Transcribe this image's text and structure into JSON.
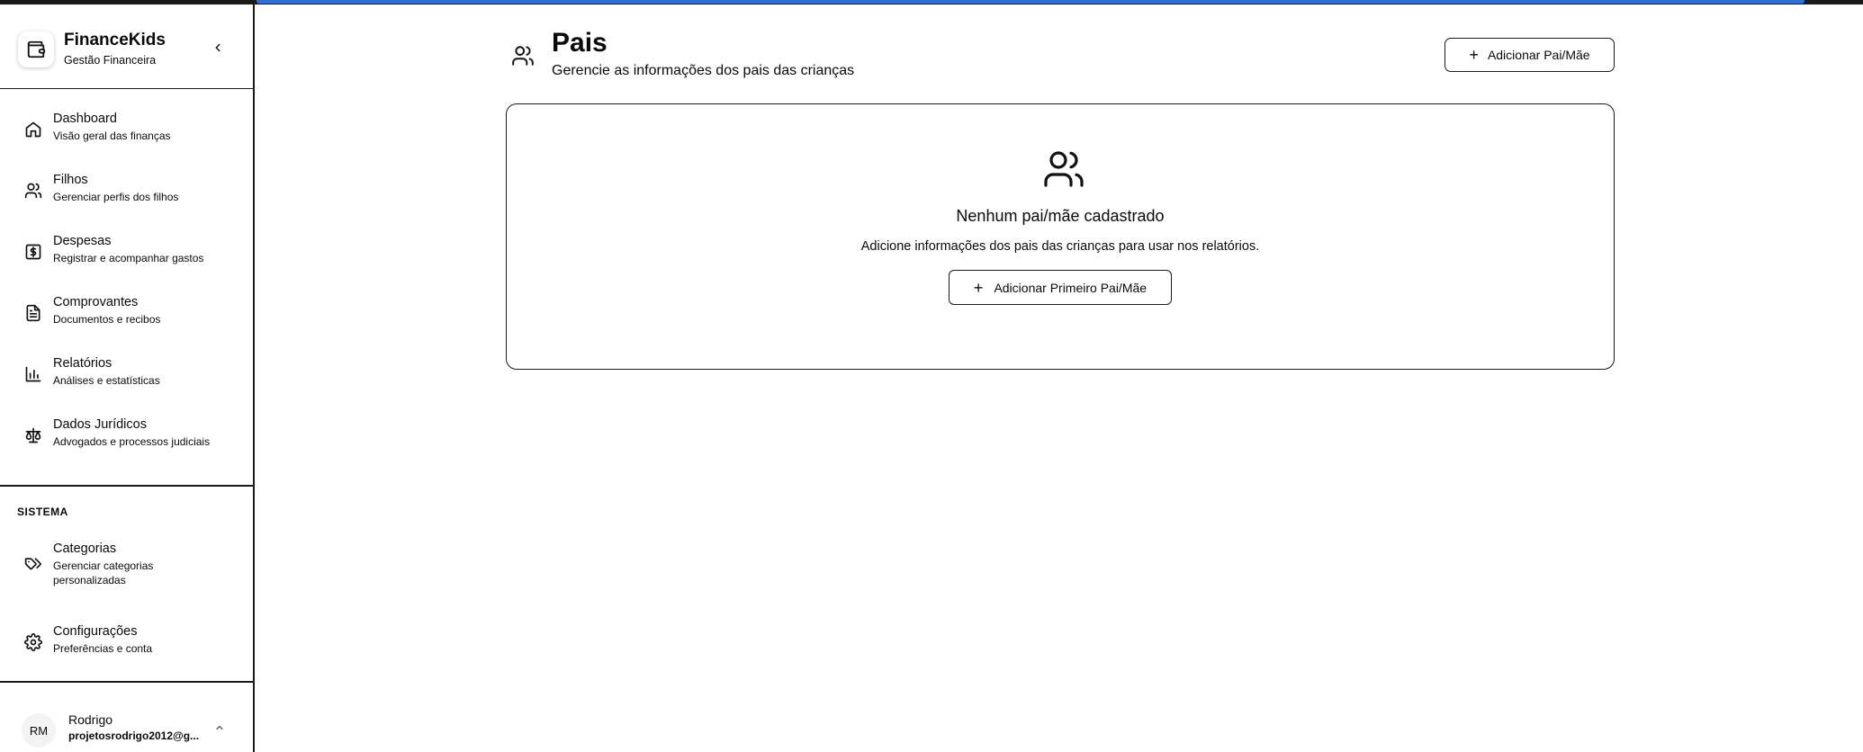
{
  "sidebar": {
    "brand": {
      "name": "FinanceKids",
      "subtitle": "Gestão Financeira",
      "logo_icon": "wallet-icon"
    },
    "collapse_icon": "chevron-left-icon",
    "nav_items": [
      {
        "title": "Dashboard",
        "desc": "Visão geral das finanças",
        "icon": "home-icon"
      },
      {
        "title": "Filhos",
        "desc": "Gerenciar perfis dos filhos",
        "icon": "users-icon"
      },
      {
        "title": "Despesas",
        "desc": "Registrar e acompanhar gastos",
        "icon": "dollar-square-icon"
      },
      {
        "title": "Comprovantes",
        "desc": "Documentos e recibos",
        "icon": "file-text-icon"
      },
      {
        "title": "Relatórios",
        "desc": "Análises e estatísticas",
        "icon": "bar-chart-icon"
      },
      {
        "title": "Dados Jurídicos",
        "desc": "Advogados e processos judiciais",
        "icon": "scale-icon"
      }
    ],
    "section_label": "SISTEMA",
    "system_items": [
      {
        "title": "Categorias",
        "desc": "Gerenciar categorias personalizadas",
        "icon": "tags-icon"
      },
      {
        "title": "Configurações",
        "desc": "Preferências e conta",
        "icon": "gear-icon"
      }
    ],
    "user": {
      "initials": "RM",
      "name": "Rodrigo",
      "email": "projetosrodrigo2012@g...",
      "chevron_icon": "chevron-up-icon"
    }
  },
  "header": {
    "icon": "users-icon",
    "title": "Pais",
    "subtitle": "Gerencie as informações dos pais das crianças",
    "add_button": "Adicionar Pai/Mãe",
    "add_icon": "plus-icon"
  },
  "empty_state": {
    "icon": "users-icon",
    "title": "Nenhum pai/mãe cadastrado",
    "text": "Adicione informações dos pais das crianças para usar nos relatórios.",
    "button": "Adicionar Primeiro Pai/Mãe",
    "button_icon": "plus-icon"
  },
  "colors": {
    "accent": "#2f6fd6",
    "border": "#1a1a1a",
    "background": "#ffffff",
    "text": "#0a0a0a"
  }
}
